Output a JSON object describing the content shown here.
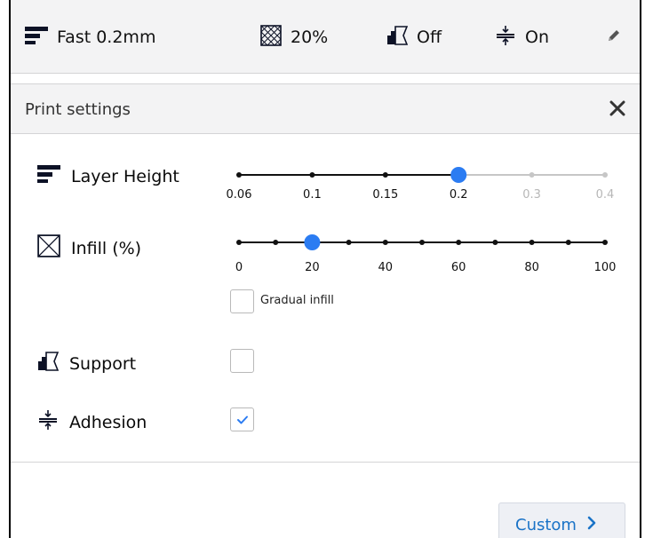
{
  "header": {
    "profile_icon": "layer-height-icon",
    "profile_label": "Fast 0.2mm",
    "infill_icon": "infill-icon",
    "infill_label": "20%",
    "support_icon": "support-icon",
    "support_label": "Off",
    "adhesion_icon": "adhesion-icon",
    "adhesion_label": "On",
    "edit_icon": "pencil-icon"
  },
  "panel": {
    "title": "Print settings",
    "close_icon": "close-icon",
    "accent_color": "#2b7cf2",
    "link_color": "#1a73c7"
  },
  "layer_height": {
    "label": "Layer Height",
    "icon": "layer-height-icon",
    "ticks": [
      "0.06",
      "0.1",
      "0.15",
      "0.2",
      "0.3",
      "0.4"
    ],
    "enabled_count": 4,
    "selected_index": 3
  },
  "infill": {
    "label": "Infill (%)",
    "icon": "infill-icon",
    "ticks": [
      "0",
      "20",
      "40",
      "60",
      "80",
      "100"
    ],
    "steps": 11,
    "value": 20,
    "gradual_label": "Gradual infill",
    "gradual_checked": false
  },
  "support": {
    "label": "Support",
    "icon": "support-icon",
    "checked": false
  },
  "adhesion": {
    "label": "Adhesion",
    "icon": "adhesion-icon",
    "checked": true
  },
  "footer": {
    "custom_label": "Custom",
    "custom_icon": "chevron-right-icon"
  }
}
